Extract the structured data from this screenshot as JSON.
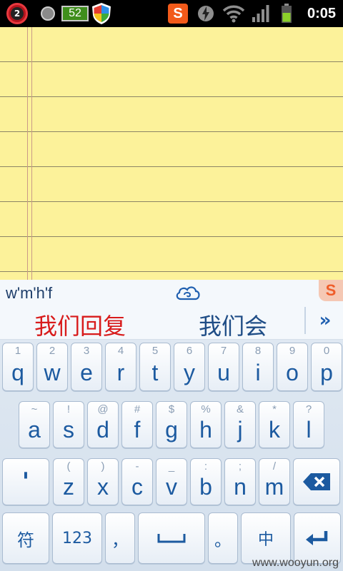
{
  "status_bar": {
    "notification_badge": "2",
    "battery_badge": "52",
    "sogou_letter": "S",
    "time": "0:05",
    "icons": [
      "notification-alarm-icon",
      "circle-app-icon",
      "battery-badge-icon",
      "shield-icon",
      "sogou-icon",
      "power-icon",
      "wifi-icon",
      "signal-icon",
      "battery-icon"
    ]
  },
  "notepad": {
    "background_color": "#fcf29a",
    "line_color": "#8c8566"
  },
  "candidate_bar": {
    "pinyin": "w'm'h'f",
    "cloud_icon": "cloud-icon",
    "sogou_letter": "S",
    "candidates": [
      "我们回复",
      "我们会"
    ],
    "highlight_color": "#d81b1b",
    "more_label": "»"
  },
  "keyboard": {
    "row1": [
      {
        "hint": "1",
        "label": "q"
      },
      {
        "hint": "2",
        "label": "w"
      },
      {
        "hint": "3",
        "label": "e"
      },
      {
        "hint": "4",
        "label": "r"
      },
      {
        "hint": "5",
        "label": "t"
      },
      {
        "hint": "6",
        "label": "y"
      },
      {
        "hint": "7",
        "label": "u"
      },
      {
        "hint": "8",
        "label": "i"
      },
      {
        "hint": "9",
        "label": "o"
      },
      {
        "hint": "0",
        "label": "p"
      }
    ],
    "row2": [
      {
        "hint": "~",
        "label": "a"
      },
      {
        "hint": "!",
        "label": "s"
      },
      {
        "hint": "@",
        "label": "d"
      },
      {
        "hint": "#",
        "label": "f"
      },
      {
        "hint": "$",
        "label": "g"
      },
      {
        "hint": "%",
        "label": "h"
      },
      {
        "hint": "&",
        "label": "j"
      },
      {
        "hint": "*",
        "label": "k"
      },
      {
        "hint": "?",
        "label": "l"
      }
    ],
    "row3": {
      "separator": "'",
      "letters": [
        {
          "hint": "(",
          "label": "z"
        },
        {
          "hint": ")",
          "label": "x"
        },
        {
          "hint": "-",
          "label": "c"
        },
        {
          "hint": "_",
          "label": "v"
        },
        {
          "hint": ":",
          "label": "b"
        },
        {
          "hint": ";",
          "label": "n"
        },
        {
          "hint": "/",
          "label": "m"
        }
      ],
      "backspace_icon": "backspace-icon"
    },
    "row4": {
      "symbols": "符",
      "numbers": "123",
      "comma": "，",
      "space_icon": "space-bar-icon",
      "period": "。",
      "language": "中",
      "enter_icon": "enter-icon"
    },
    "accent_color": "#1c5aa0"
  },
  "watermark": "www.wooyun.org"
}
